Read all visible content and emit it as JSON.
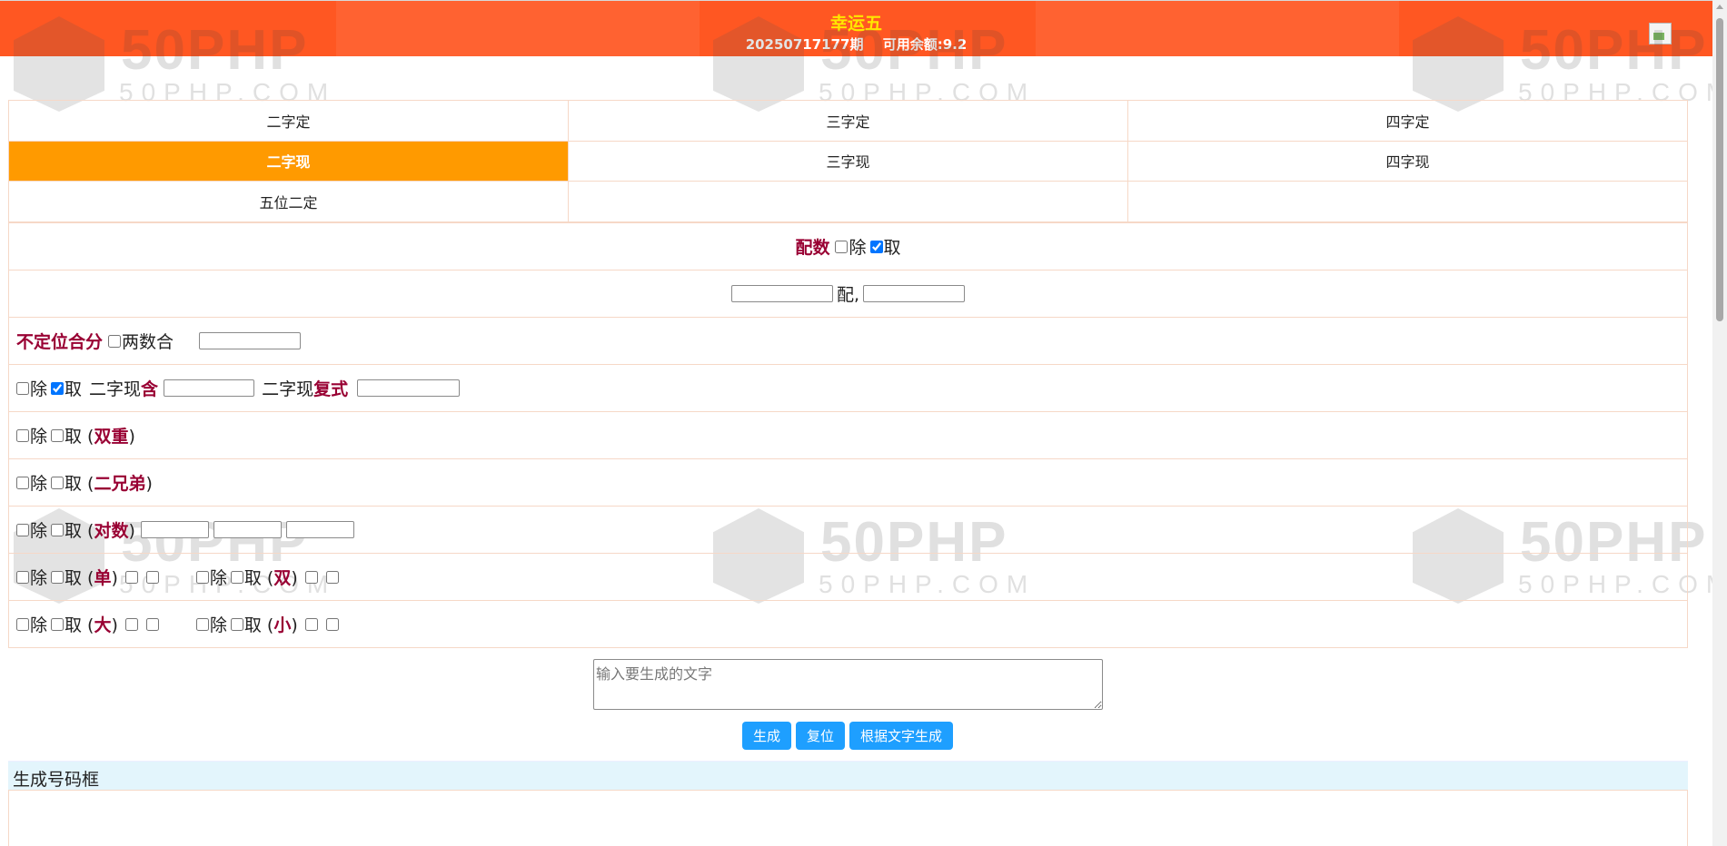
{
  "header": {
    "title": "幸运五",
    "period": "20250717177期",
    "balance": "可用余额:9.2"
  },
  "watermark": {
    "brand": "50PHP",
    "domain": "50PHP.COM"
  },
  "tabs": [
    [
      "二字定",
      "三字定",
      "四字定"
    ],
    [
      "二字现",
      "三字现",
      "四字现"
    ],
    [
      "五位二定",
      "",
      ""
    ]
  ],
  "active_tab": "二字现",
  "form": {
    "peishu": {
      "label": "配数",
      "exclude": "除",
      "take": "取",
      "exclude_checked": false,
      "take_checked": true
    },
    "pei_row": {
      "joiner": "配,"
    },
    "budingwei": {
      "label": "不定位合分",
      "option": "两数合"
    },
    "contain": {
      "exclude": "除",
      "take": "取",
      "prefix1": "二字现",
      "red1": "含",
      "prefix2": "二字现",
      "red2": "复式"
    },
    "double": {
      "exclude": "除",
      "take": "取",
      "label": "双重"
    },
    "brothers": {
      "exclude": "除",
      "take": "取",
      "label": "二兄弟"
    },
    "pairs": {
      "exclude": "除",
      "take": "取",
      "label": "对数"
    },
    "odd_even": {
      "exclude": "除",
      "take": "取",
      "odd": "单",
      "even": "双"
    },
    "big_small": {
      "exclude": "除",
      "take": "取",
      "big": "大",
      "small": "小"
    }
  },
  "textarea": {
    "placeholder": "输入要生成的文字"
  },
  "buttons": {
    "generate": "生成",
    "reset": "复位",
    "from_text": "根据文字生成"
  },
  "result": {
    "title": "生成号码框"
  },
  "colors": {
    "header": "#ff5722",
    "title": "#ffe600",
    "active_tab": "#ff9a00",
    "button": "#1e9fff",
    "accent_text": "#990033"
  }
}
